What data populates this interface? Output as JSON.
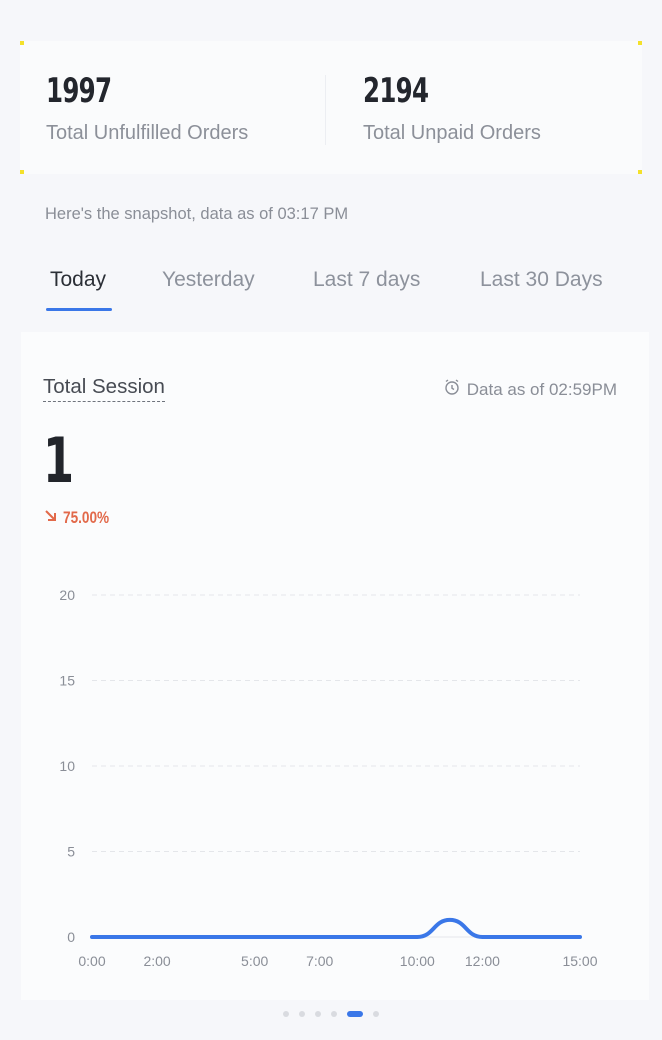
{
  "stats": [
    {
      "value": "1997",
      "label": "Total Unfulfilled Orders"
    },
    {
      "value": "2194",
      "label": "Total Unpaid Orders"
    }
  ],
  "snapshot_text": "Here's the snapshot, data as of 03:17 PM",
  "tabs": [
    {
      "label": "Today",
      "active": true
    },
    {
      "label": "Yesterday",
      "active": false
    },
    {
      "label": "Last 7 days",
      "active": false
    },
    {
      "label": "Last 30 Days",
      "active": false
    }
  ],
  "session": {
    "title": "Total Session",
    "data_as_of": "Data as of 02:59PM",
    "value": "1",
    "change": "75.00%",
    "change_direction": "down"
  },
  "colors": {
    "accent": "#3a77e8",
    "negative": "#e2694a"
  },
  "chart_data": {
    "type": "line",
    "x_ticks": [
      "0:00",
      "2:00",
      "5:00",
      "7:00",
      "10:00",
      "12:00",
      "15:00"
    ],
    "y_ticks": [
      0,
      5,
      10,
      15,
      20
    ],
    "ylim": [
      0,
      20
    ],
    "grid": true,
    "series": [
      {
        "x": [
          "0:00",
          "1:00",
          "2:00",
          "3:00",
          "4:00",
          "5:00",
          "6:00",
          "7:00",
          "8:00",
          "9:00",
          "10:00",
          "11:00",
          "12:00",
          "13:00",
          "14:00",
          "15:00"
        ],
        "values": [
          0,
          0,
          0,
          0,
          0,
          0,
          0,
          0,
          0,
          0,
          0,
          1,
          0,
          0,
          0,
          0
        ]
      }
    ]
  },
  "pagination": {
    "count": 6,
    "active": 4
  }
}
